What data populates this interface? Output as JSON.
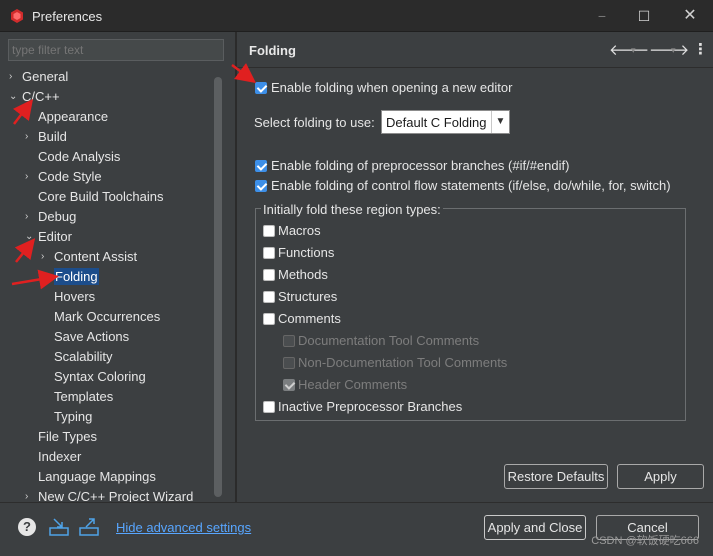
{
  "window": {
    "title": "Preferences",
    "minimize": "−",
    "maximize": "☐",
    "close": "✕"
  },
  "filter": {
    "placeholder": "type filter text"
  },
  "tree": [
    {
      "label": "General",
      "level": 0,
      "arrow": "›"
    },
    {
      "label": "C/C++",
      "level": 0,
      "arrow": "⌄"
    },
    {
      "label": "Appearance",
      "level": 1,
      "arrow": ""
    },
    {
      "label": "Build",
      "level": 1,
      "arrow": "›"
    },
    {
      "label": "Code Analysis",
      "level": 1,
      "arrow": ""
    },
    {
      "label": "Code Style",
      "level": 1,
      "arrow": "›"
    },
    {
      "label": "Core Build Toolchains",
      "level": 1,
      "arrow": ""
    },
    {
      "label": "Debug",
      "level": 1,
      "arrow": "›"
    },
    {
      "label": "Editor",
      "level": 1,
      "arrow": "⌄"
    },
    {
      "label": "Content Assist",
      "level": 2,
      "arrow": "›"
    },
    {
      "label": "Folding",
      "level": 2,
      "arrow": "",
      "selected": true
    },
    {
      "label": "Hovers",
      "level": 2,
      "arrow": ""
    },
    {
      "label": "Mark Occurrences",
      "level": 2,
      "arrow": ""
    },
    {
      "label": "Save Actions",
      "level": 2,
      "arrow": ""
    },
    {
      "label": "Scalability",
      "level": 2,
      "arrow": ""
    },
    {
      "label": "Syntax Coloring",
      "level": 2,
      "arrow": ""
    },
    {
      "label": "Templates",
      "level": 2,
      "arrow": ""
    },
    {
      "label": "Typing",
      "level": 2,
      "arrow": ""
    },
    {
      "label": "File Types",
      "level": 1,
      "arrow": ""
    },
    {
      "label": "Indexer",
      "level": 1,
      "arrow": ""
    },
    {
      "label": "Language Mappings",
      "level": 1,
      "arrow": ""
    },
    {
      "label": "New C/C++ Project Wizard",
      "level": 1,
      "arrow": "›"
    }
  ],
  "page": {
    "title": "Folding",
    "nav_back": "🡐",
    "nav_forward": "🡒",
    "nav_dropdown": "▾",
    "menu": "⋮",
    "enable_folding": {
      "label": "Enable folding when opening a new editor",
      "checked": true
    },
    "select_label": "Select folding to use:",
    "select_value": "Default C Folding",
    "preprocessor": {
      "label": "Enable folding of preprocessor branches (#if/#endif)",
      "checked": true
    },
    "control_flow": {
      "label": "Enable folding of control flow statements (if/else, do/while, for, switch)",
      "checked": true
    },
    "group_title": "Initially fold these region types:",
    "regions": [
      {
        "label": "Macros",
        "state": "unchecked"
      },
      {
        "label": "Functions",
        "state": "unchecked"
      },
      {
        "label": "Methods",
        "state": "unchecked"
      },
      {
        "label": "Structures",
        "state": "unchecked"
      },
      {
        "label": "Comments",
        "state": "unchecked"
      },
      {
        "label": "Documentation Tool Comments",
        "state": "disabled"
      },
      {
        "label": "Non-Documentation Tool Comments",
        "state": "disabled"
      },
      {
        "label": "Header Comments",
        "state": "disabled-checked"
      },
      {
        "label": "Inactive Preprocessor Branches",
        "state": "unchecked"
      }
    ],
    "restore_defaults": "Restore Defaults",
    "apply": "Apply"
  },
  "bottom": {
    "hide_advanced": "Hide advanced settings",
    "apply_and_close": "Apply and Close",
    "cancel": "Cancel",
    "watermark": "CSDN @软饭硬吃666"
  },
  "colors": {
    "accent": "#3d8fe8",
    "link": "#58a6ff",
    "annotation": "#e02020"
  }
}
